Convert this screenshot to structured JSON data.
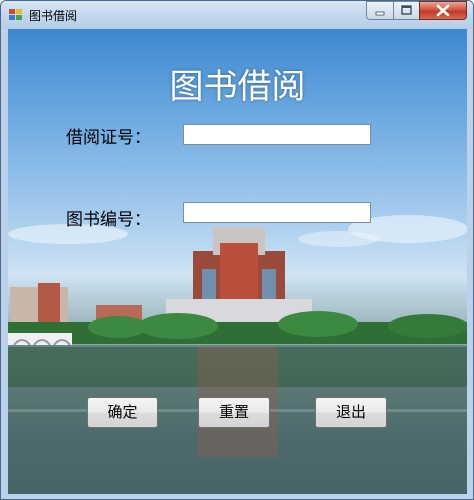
{
  "window": {
    "title": "图书借阅"
  },
  "form": {
    "heading": "图书借阅",
    "card_label": "借阅证号：",
    "card_value": "",
    "book_label": "图书编号：",
    "book_value": ""
  },
  "buttons": {
    "confirm": "确定",
    "reset": "重置",
    "exit": "退出"
  },
  "colors": {
    "title_bar": "#c3d7ee",
    "close_button": "#c9412a",
    "heading_text": "#ffffff"
  }
}
